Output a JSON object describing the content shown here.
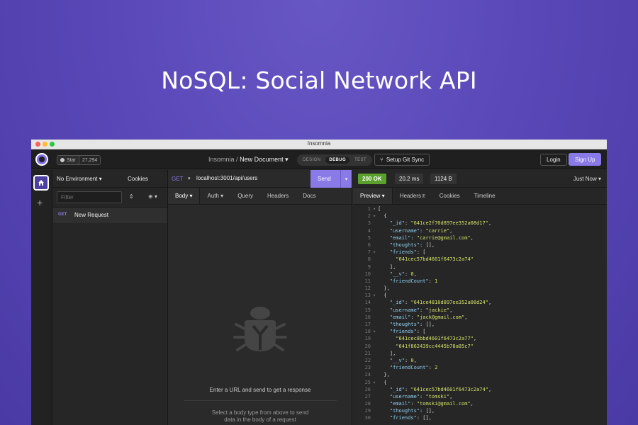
{
  "hero": {
    "title": "NoSQL: Social Network API"
  },
  "window": {
    "title": "Insomnia"
  },
  "appbar": {
    "star_label": "Star",
    "star_count": "27,294",
    "crumb_app": "Insomnia",
    "crumb_sep": "/",
    "crumb_doc": "New Document",
    "modes": [
      "DESIGN",
      "DEBUG",
      "TEST"
    ],
    "active_mode": "DEBUG",
    "git_sync_label": "Setup Git Sync",
    "login_label": "Login",
    "signup_label": "Sign Up"
  },
  "sidebar": {
    "environment": "No Environment",
    "cookies": "Cookies",
    "filter_placeholder": "Filter",
    "requests": [
      {
        "method": "GET",
        "name": "New Request"
      }
    ]
  },
  "request": {
    "method": "GET",
    "url": "localhost:3001/api/users",
    "send_label": "Send",
    "tabs": [
      "Body",
      "Auth",
      "Query",
      "Headers",
      "Docs"
    ],
    "empty_message": "Enter a URL and send to get a response",
    "hint_line1": "Select a body type from above to send",
    "hint_line2": "data in the body of a request"
  },
  "response": {
    "status": "200 OK",
    "time": "20.2 ms",
    "size": "1124 B",
    "when": "Just Now",
    "tabs": [
      "Preview",
      "Headers",
      "Cookies",
      "Timeline"
    ],
    "headers_count": "7",
    "lines": [
      {
        "n": "1",
        "fold": "▾",
        "parts": [
          [
            "t",
            "["
          ]
        ]
      },
      {
        "n": "2",
        "fold": "▾",
        "parts": [
          [
            "t",
            "  {"
          ]
        ]
      },
      {
        "n": "3",
        "fold": "",
        "parts": [
          [
            "t",
            "    "
          ],
          [
            "k",
            "\"_id\""
          ],
          [
            "t",
            ": "
          ],
          [
            "s",
            "\"641ce2f70d897ee352a08d17\""
          ],
          [
            "t",
            ","
          ]
        ]
      },
      {
        "n": "4",
        "fold": "",
        "parts": [
          [
            "t",
            "    "
          ],
          [
            "k",
            "\"username\""
          ],
          [
            "t",
            ": "
          ],
          [
            "s",
            "\"carrie\""
          ],
          [
            "t",
            ","
          ]
        ]
      },
      {
        "n": "5",
        "fold": "",
        "parts": [
          [
            "t",
            "    "
          ],
          [
            "k",
            "\"email\""
          ],
          [
            "t",
            ": "
          ],
          [
            "s",
            "\"carrie@gmail.com\""
          ],
          [
            "t",
            ","
          ]
        ]
      },
      {
        "n": "6",
        "fold": "",
        "parts": [
          [
            "t",
            "    "
          ],
          [
            "k",
            "\"thoughts\""
          ],
          [
            "t",
            ": [],"
          ]
        ]
      },
      {
        "n": "7",
        "fold": "▾",
        "parts": [
          [
            "t",
            "    "
          ],
          [
            "k",
            "\"friends\""
          ],
          [
            "t",
            ": ["
          ]
        ]
      },
      {
        "n": "8",
        "fold": "",
        "parts": [
          [
            "t",
            "      "
          ],
          [
            "s",
            "\"641cec57bd4601f6473c2a74\""
          ]
        ]
      },
      {
        "n": "9",
        "fold": "",
        "parts": [
          [
            "t",
            "    ],"
          ]
        ]
      },
      {
        "n": "10",
        "fold": "",
        "parts": [
          [
            "t",
            "    "
          ],
          [
            "k",
            "\"__v\""
          ],
          [
            "t",
            ": "
          ],
          [
            "n",
            "0"
          ],
          [
            "t",
            ","
          ]
        ]
      },
      {
        "n": "11",
        "fold": "",
        "parts": [
          [
            "t",
            "    "
          ],
          [
            "k",
            "\"friendCount\""
          ],
          [
            "t",
            ": "
          ],
          [
            "n",
            "1"
          ]
        ]
      },
      {
        "n": "12",
        "fold": "",
        "parts": [
          [
            "t",
            "  },"
          ]
        ]
      },
      {
        "n": "13",
        "fold": "▾",
        "parts": [
          [
            "t",
            "  {"
          ]
        ]
      },
      {
        "n": "14",
        "fold": "",
        "parts": [
          [
            "t",
            "    "
          ],
          [
            "k",
            "\"_id\""
          ],
          [
            "t",
            ": "
          ],
          [
            "s",
            "\"641ce4810d897ee352a08d24\""
          ],
          [
            "t",
            ","
          ]
        ]
      },
      {
        "n": "15",
        "fold": "",
        "parts": [
          [
            "t",
            "    "
          ],
          [
            "k",
            "\"username\""
          ],
          [
            "t",
            ": "
          ],
          [
            "s",
            "\"jackie\""
          ],
          [
            "t",
            ","
          ]
        ]
      },
      {
        "n": "16",
        "fold": "",
        "parts": [
          [
            "t",
            "    "
          ],
          [
            "k",
            "\"email\""
          ],
          [
            "t",
            ": "
          ],
          [
            "s",
            "\"jack@gmail.com\""
          ],
          [
            "t",
            ","
          ]
        ]
      },
      {
        "n": "17",
        "fold": "",
        "parts": [
          [
            "t",
            "    "
          ],
          [
            "k",
            "\"thoughts\""
          ],
          [
            "t",
            ": [],"
          ]
        ]
      },
      {
        "n": "18",
        "fold": "▾",
        "parts": [
          [
            "t",
            "    "
          ],
          [
            "k",
            "\"friends\""
          ],
          [
            "t",
            ": ["
          ]
        ]
      },
      {
        "n": "19",
        "fold": "",
        "parts": [
          [
            "t",
            "      "
          ],
          [
            "s",
            "\"641cec8bbd4601f6473c2a77\""
          ],
          [
            "t",
            ","
          ]
        ]
      },
      {
        "n": "20",
        "fold": "",
        "parts": [
          [
            "t",
            "      "
          ],
          [
            "s",
            "\"641f862439cc4445b78a85c7\""
          ]
        ]
      },
      {
        "n": "21",
        "fold": "",
        "parts": [
          [
            "t",
            "    ],"
          ]
        ]
      },
      {
        "n": "22",
        "fold": "",
        "parts": [
          [
            "t",
            "    "
          ],
          [
            "k",
            "\"__v\""
          ],
          [
            "t",
            ": "
          ],
          [
            "n",
            "0"
          ],
          [
            "t",
            ","
          ]
        ]
      },
      {
        "n": "23",
        "fold": "",
        "parts": [
          [
            "t",
            "    "
          ],
          [
            "k",
            "\"friendCount\""
          ],
          [
            "t",
            ": "
          ],
          [
            "n",
            "2"
          ]
        ]
      },
      {
        "n": "24",
        "fold": "",
        "parts": [
          [
            "t",
            "  },"
          ]
        ]
      },
      {
        "n": "25",
        "fold": "▾",
        "parts": [
          [
            "t",
            "  {"
          ]
        ]
      },
      {
        "n": "26",
        "fold": "",
        "parts": [
          [
            "t",
            "    "
          ],
          [
            "k",
            "\"_id\""
          ],
          [
            "t",
            ": "
          ],
          [
            "s",
            "\"641cec57bd4601f6473c2a74\""
          ],
          [
            "t",
            ","
          ]
        ]
      },
      {
        "n": "27",
        "fold": "",
        "parts": [
          [
            "t",
            "    "
          ],
          [
            "k",
            "\"username\""
          ],
          [
            "t",
            ": "
          ],
          [
            "s",
            "\"tomski\""
          ],
          [
            "t",
            ","
          ]
        ]
      },
      {
        "n": "28",
        "fold": "",
        "parts": [
          [
            "t",
            "    "
          ],
          [
            "k",
            "\"email\""
          ],
          [
            "t",
            ": "
          ],
          [
            "s",
            "\"tomski@gmail.com\""
          ],
          [
            "t",
            ","
          ]
        ]
      },
      {
        "n": "29",
        "fold": "",
        "parts": [
          [
            "t",
            "    "
          ],
          [
            "k",
            "\"thoughts\""
          ],
          [
            "t",
            ": [],"
          ]
        ]
      },
      {
        "n": "30",
        "fold": "",
        "parts": [
          [
            "t",
            "    "
          ],
          [
            "k",
            "\"friends\""
          ],
          [
            "t",
            ": [],"
          ]
        ]
      }
    ]
  },
  "colors": {
    "accent": "#8a7ae8",
    "success": "#5aa02c",
    "background": "#5a48b8"
  }
}
